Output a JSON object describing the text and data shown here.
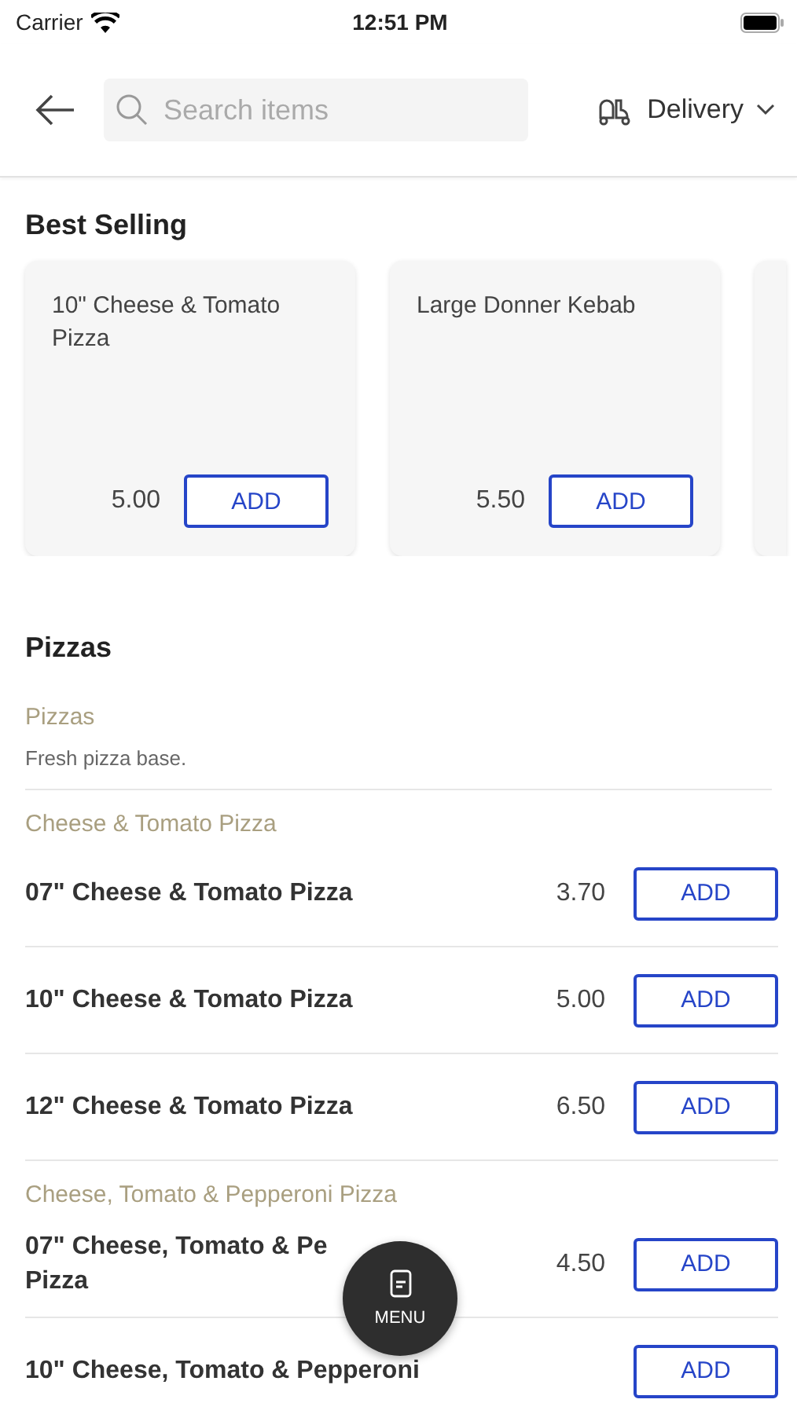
{
  "status_bar": {
    "carrier": "Carrier",
    "time": "12:51 PM"
  },
  "header": {
    "search": {
      "placeholder": "Search items"
    },
    "mode": "Delivery"
  },
  "best_selling": {
    "title": "Best Selling",
    "items": [
      {
        "name": "10\" Cheese & Tomato Pizza",
        "price": "5.00",
        "button": "ADD"
      },
      {
        "name": "Large Donner Kebab",
        "price": "5.50",
        "button": "ADD"
      }
    ]
  },
  "section": {
    "title": "Pizzas",
    "groups": [
      {
        "title": "Pizzas",
        "description": "Fresh pizza base."
      },
      {
        "title": "Cheese & Tomato Pizza",
        "items": [
          {
            "name": "07\" Cheese & Tomato Pizza",
            "price": "3.70",
            "button": "ADD"
          },
          {
            "name": "10\" Cheese & Tomato Pizza",
            "price": "5.00",
            "button": "ADD"
          },
          {
            "name": "12\" Cheese & Tomato Pizza",
            "price": "6.50",
            "button": "ADD"
          }
        ]
      },
      {
        "title": "Cheese, Tomato & Pepperoni Pizza",
        "items": [
          {
            "name": "07\" Cheese, Tomato & Pe",
            "name_line2": "Pizza",
            "price": "4.50",
            "button": "ADD"
          },
          {
            "name": "10\" Cheese, Tomato & Pepperoni",
            "button": "ADD"
          }
        ]
      }
    ]
  },
  "fab": {
    "label": "MENU"
  }
}
